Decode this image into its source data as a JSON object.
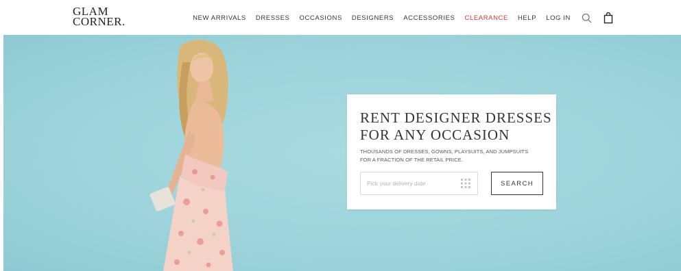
{
  "logo": {
    "line1": "GLAM",
    "line2": "CORNER."
  },
  "nav": {
    "items": [
      {
        "label": "NEW ARRIVALS"
      },
      {
        "label": "DRESSES"
      },
      {
        "label": "OCCASIONS"
      },
      {
        "label": "DESIGNERS"
      },
      {
        "label": "ACCESSORIES"
      },
      {
        "label": "CLEARANCE"
      },
      {
        "label": "HELP"
      },
      {
        "label": "LOG IN"
      }
    ],
    "icons": {
      "search": "search-icon",
      "bag": "shopping-bag-icon"
    }
  },
  "hero": {
    "title_line1": "RENT DESIGNER DRESSES",
    "title_line2": "FOR ANY OCCASION",
    "subtitle_line1": "THOUSANDS OF DRESSES, GOWNS, PLAYSUITS, AND JUMPSUITS",
    "subtitle_line2": "FOR A FRACTION OF THE RETAIL PRICE.",
    "date_placeholder": "Pick your delivery date",
    "search_label": "SEARCH"
  },
  "colors": {
    "hero_background": "#a3d7de",
    "clearance": "#d9363e",
    "text": "#333333"
  }
}
